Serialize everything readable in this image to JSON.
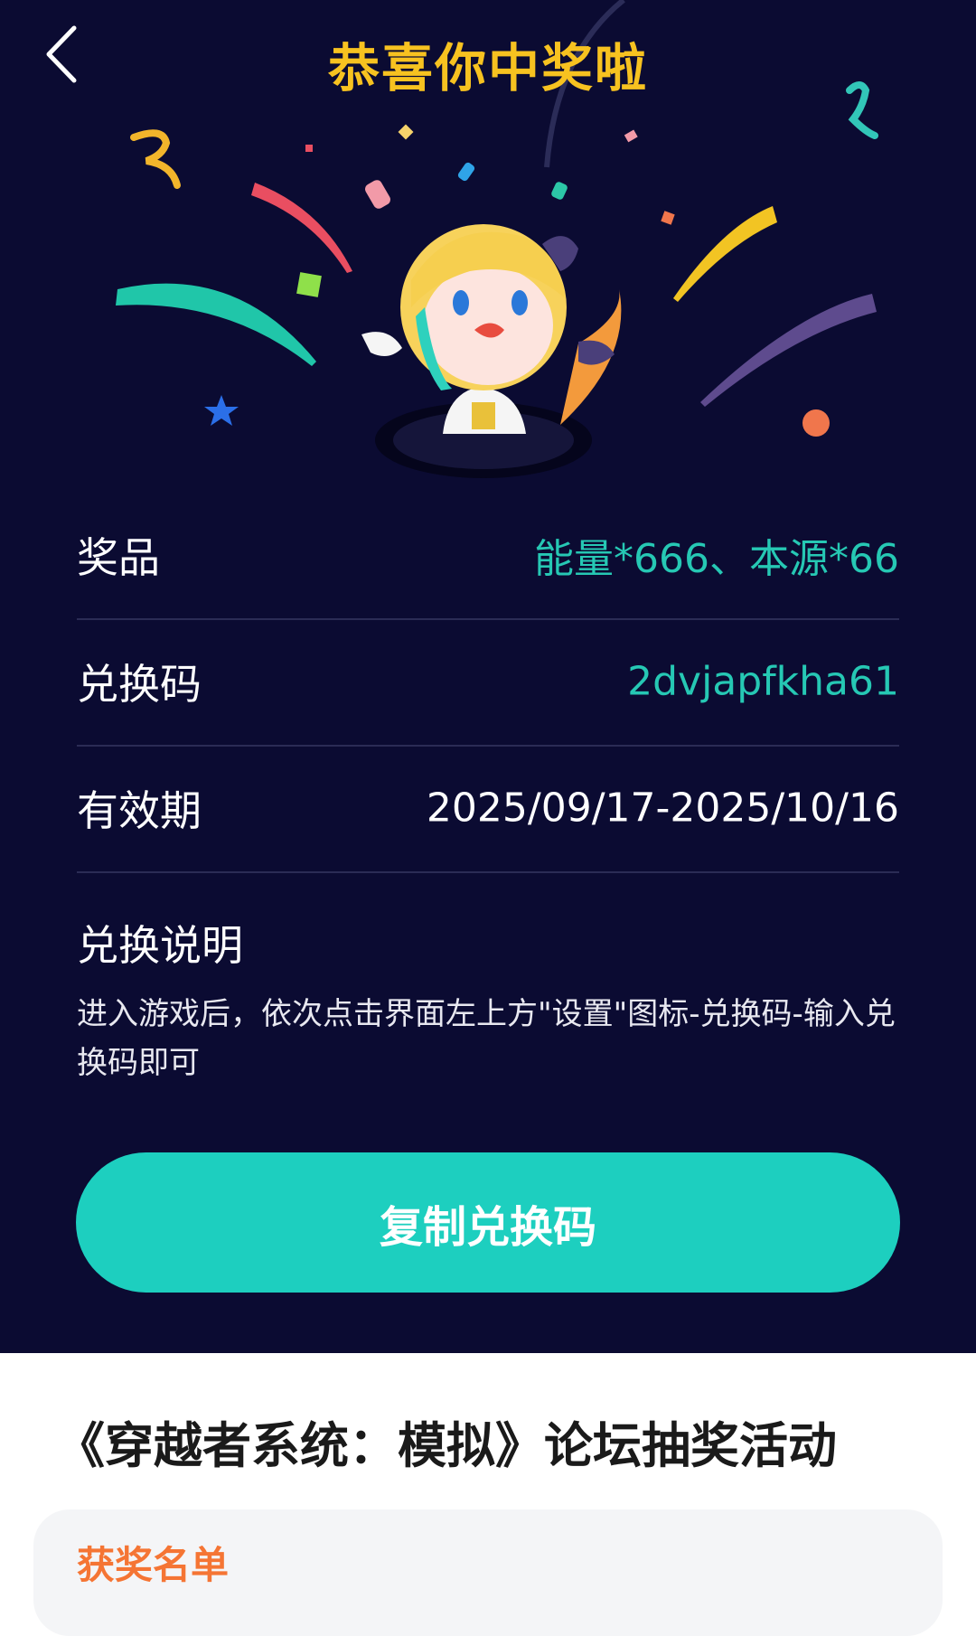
{
  "header": {
    "title": "恭喜你中奖啦"
  },
  "details": {
    "prize_label": "奖品",
    "prize_value": "能量*666、本源*66",
    "code_label": "兑换码",
    "code_value": "2dvjapfkha61",
    "validity_label": "有效期",
    "validity_value": "2025/09/17-2025/10/16"
  },
  "instructions": {
    "title": "兑换说明",
    "text": "进入游戏后，依次点击界面左上方\"设置\"图标-兑换码-输入兑换码即可"
  },
  "actions": {
    "copy_label": "复制兑换码"
  },
  "event": {
    "title": "《穿越者系统：模拟》论坛抽奖活动",
    "winners_title": "获奖名单"
  },
  "colors": {
    "background": "#0b0b32",
    "title": "#f7c220",
    "accent": "#1dcfbf",
    "orange": "#f57534"
  },
  "icons": {
    "back": "chevron-left-icon"
  }
}
